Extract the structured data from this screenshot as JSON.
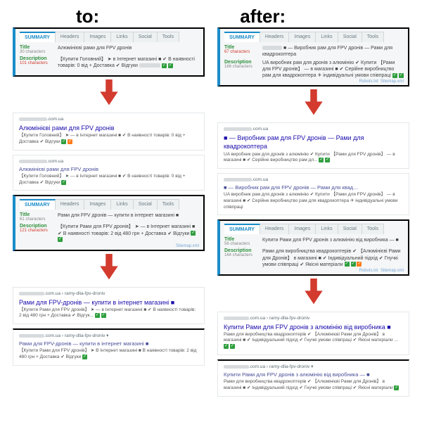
{
  "headers": {
    "to": "to:",
    "after": "after:"
  },
  "tabs": [
    "SUMMARY",
    "Headers",
    "Images",
    "Links",
    "Social",
    "Tools"
  ],
  "labels": {
    "title": "Title",
    "desc": "Description"
  },
  "left": {
    "panel1": {
      "titleChars": "30 characters",
      "titleVal": "Алюмінієві рами для FPV дронів",
      "descChars": "101 characters",
      "descVal": "【Купити Головний】 ➤ в Інтернет магазині ■ ✔ В наявності товарів: 0 від + Доставка ✔ Відгуки"
    },
    "serp1": {
      "title": "Алюмінієві рами для FPV дронів",
      "desc": "【Купити Головний】 ➤ — в Інтернет магазині ■ ✔ В наявності товарів: 0 від + Доставка ✔ Відгуки"
    },
    "serp2": {
      "title": "Алюмінієві рами для FPV дронів",
      "desc": "【Купити Головний】 ➤ — в Інтернет магазині ■ ✔ В наявності товарів: 0 від + Доставка ✔ Відгуки"
    },
    "panel2": {
      "titleChars": "61 characters",
      "titleVal": "Рами для FPV дронів — купити в інтернет магазині ■",
      "descChars": "121 characters",
      "descVal": "【Купити Рами для FPV дронів】 ➤ — в Інтернет магазині ■ ✔ В наявності товарів: 2 від 480 грн + Доставка ✔ Відгуки"
    },
    "serp3": {
      "urlTail": ".com.ua › ramy-dlia-fpv-droniv",
      "title": "Рами для FPV-дронів — купити в інтернет магазині ■",
      "desc": "【Купити Рами для FPV дронів】 ➤ — в Інтернет магазині ■ ✔ В наявності товарів: 2 від 480 грн + Доставка ✔ Відгук..."
    },
    "serp4": {
      "urlTail": ".com.ua › ramy-dlia-fpv-droniv ▾",
      "title": "Рами для FPV-дронів — купити в інтернет магазині ■",
      "desc": "【Купити Рами для FPV дронів】 ➤ В Інтернет магазині ■ В наявності товарів: 2 від 480 грн + Доставка ✔ Відгуки"
    }
  },
  "right": {
    "panel1": {
      "titleChars": "67 characters",
      "titleVal": "■ — Виробник рам для FPV дронів — Рами для квадрокоптера",
      "descChars": "166 characters",
      "descVal": "UA виробник рам для дронів з алюмінію ✔ Купити 【Рами для FPV дронів】 — в магазині ■ ✔ Серійне виробництво рам для квадрокоптера ✈ індивідуальні умови співпраці"
    },
    "serp1": {
      "title": "■ — Виробник рам для FPV дронів — Рами для квадрокоптера",
      "desc": "UA виробник рам для дронів з алюмінію ✔ Купити 【Рами для FPV дронів】 — в магазині ■ ✔ Серійне виробництво рам дл..."
    },
    "serp2": {
      "title": "■ — Виробник рам для FPV дронів — Рами для квад...",
      "desc": "UA виробник рам для дронів з алюмінію ✔ Купити 【Рами для FPV дронів】 — в магазині ■ ✔ Серійне виробництво рам для квадрокоптера ✈ індивідуальні умови співпраці"
    },
    "panel2": {
      "titleChars": "56 characters",
      "titleVal": "Купити Рами для FPV дронів з алюмінію від виробника — ■",
      "descChars": "164 characters",
      "descVal": "Рами для виробництва квадрокоптерів ✔ 【Алюмінієві Рами для Дронів】 в магазині ■ ✔ Індивідуальний підхід ✔ Гнучкі умови співпраці ✔ Якісні матеріали"
    },
    "serp3": {
      "urlTail": ".com.ua › ramy-dlia-fpv-droniv",
      "title": "Купити Рами для FPV дронів з алюмінію від виробника ■",
      "desc": "Рами для виробництва квадрокоптерів ✔ 【Алюмінієві Рами для Дронів】 в магазині ■ ✔ Індивідуальний підхід ✔ Гнучкі умови співпраці ✔ Якісні матеріали ..."
    },
    "serp4": {
      "urlTail": ".com.ua › ramy-dlia-fpv-droniv ▾",
      "title": "Купити Рами для FPV дронів з алюмінію від виробника — ■",
      "desc": "Рами для виробництва квадрокоптерів ✔ 【Алюмінієві Рами для Дронів】 в магазині ■ ✔ Індивідуальний підхід ✔ Гнучкі умови співпраці ✔ Якісні матеріали"
    }
  },
  "footer": {
    "robots": "Robots.txt",
    "sitemap": "Sitemap.xml"
  }
}
